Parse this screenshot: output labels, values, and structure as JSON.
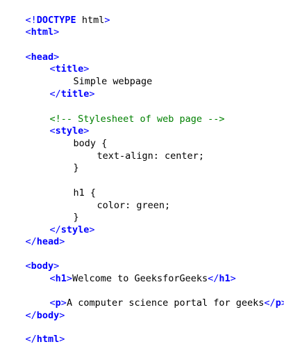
{
  "lines": {
    "doctype_open": "<!",
    "doctype_kw": "DOCTYPE",
    "doctype_rest": " html",
    "close": ">",
    "lt": "<",
    "ltslash": "</",
    "html": "html",
    "head": "head",
    "title": "title",
    "title_text": "Simple webpage",
    "comment": "<!-- Stylesheet of web page -->",
    "style": "style",
    "body_sel": "body {",
    "text_align": "text-align: center;",
    "brace_close": "}",
    "h1_sel": "h1 {",
    "color_decl": "color: green;",
    "body": "body",
    "h1": "h1",
    "h1_text": "Welcome to GeeksforGeeks",
    "p": "p",
    "p_text": "A computer science portal for geeks"
  }
}
